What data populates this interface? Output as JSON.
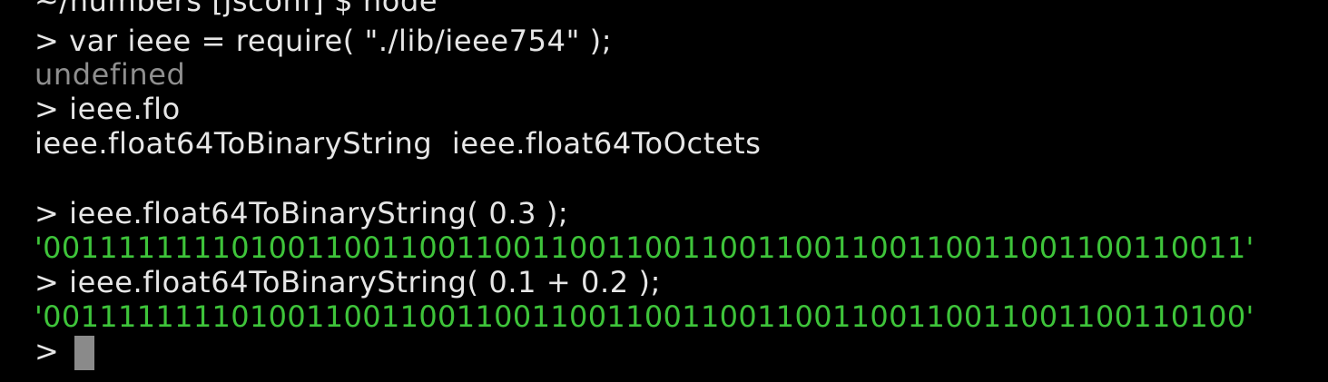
{
  "terminal": {
    "lines": [
      {
        "text": "~/numbers [jsconf] $ node",
        "style": "normal"
      },
      {
        "text": "> var ieee = require( \"./lib/ieee754\" );",
        "style": "normal"
      },
      {
        "text": "undefined",
        "style": "muted"
      },
      {
        "text": "> ieee.flo",
        "style": "normal"
      },
      {
        "text": "ieee.float64ToBinaryString  ieee.float64ToOctets",
        "style": "normal"
      },
      {
        "text": "",
        "style": "normal"
      },
      {
        "text": "> ieee.float64ToBinaryString( 0.3 );",
        "style": "normal"
      },
      {
        "text": "'0011111111010011001100110011001100110011001100110011001100110011'",
        "style": "green"
      },
      {
        "text": "> ieee.float64ToBinaryString( 0.1 + 0.2 );",
        "style": "normal"
      },
      {
        "text": "'0011111111010011001100110011001100110011001100110011001100110100'",
        "style": "green"
      },
      {
        "text": ">",
        "style": "normal"
      }
    ],
    "colors": {
      "background": "#000000",
      "text": "#e6e6e6",
      "muted": "#8f8f8f",
      "string_output": "#3ec43a",
      "cursor": "#8a8a8a"
    }
  }
}
